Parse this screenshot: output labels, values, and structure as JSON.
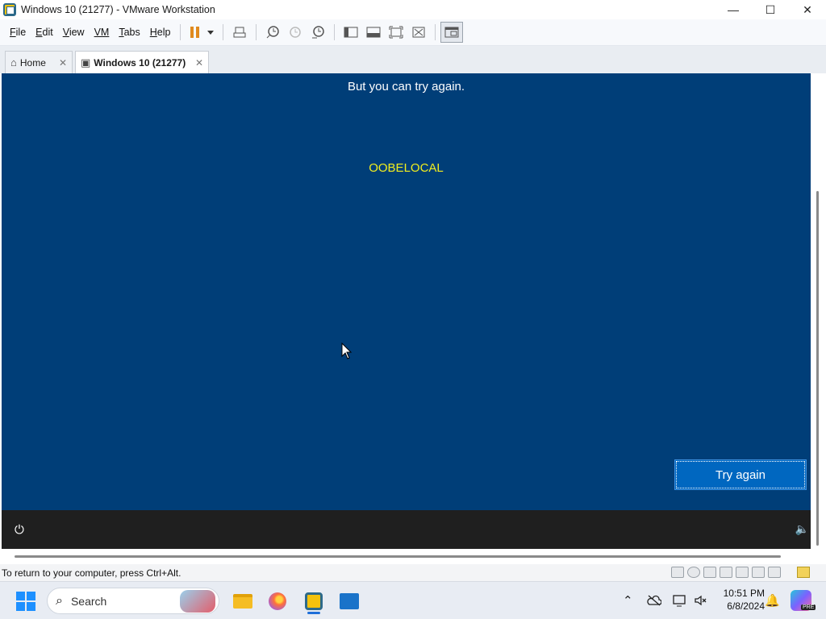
{
  "window": {
    "title": "Windows 10 (21277) - VMware Workstation",
    "controls": {
      "minimize": "—",
      "maximize": "☐",
      "close": "✕"
    }
  },
  "menu": {
    "items": [
      {
        "underline": "F",
        "rest": "ile"
      },
      {
        "underline": "E",
        "rest": "dit"
      },
      {
        "underline": "V",
        "rest": "iew"
      },
      {
        "underline": "VM",
        "rest": ""
      },
      {
        "underline": "T",
        "rest": "abs"
      },
      {
        "underline": "H",
        "rest": "elp"
      }
    ]
  },
  "toolbar": {
    "icons": [
      "pause-icon",
      "send-ctrl-alt-del-icon",
      "snapshot-take-icon",
      "snapshot-revert-icon",
      "snapshot-manager-icon",
      "library-icon",
      "thumbnail-bar-icon",
      "full-screen-icon",
      "unity-icon",
      "console-view-icon"
    ]
  },
  "tabs": [
    {
      "label": "Home",
      "close": "✕"
    },
    {
      "label": "Windows 10 (21277)",
      "close": "✕"
    }
  ],
  "vm": {
    "subtitle": "But you can try again.",
    "code": "OOBELOCAL",
    "try_again": "Try again",
    "ease_icon": "⏻",
    "volume_icon": "🔈"
  },
  "status": {
    "text": "To return to your computer, press Ctrl+Alt."
  },
  "taskbar": {
    "search_placeholder": "Search",
    "search_icon": "⌕",
    "clock_time": "10:51 PM",
    "clock_date": "6/8/2024",
    "copilot_badge": "PRE",
    "tray_icons": [
      "chevron-up-icon",
      "onedrive-icon",
      "display-icon",
      "volume-muted-icon"
    ]
  },
  "colors": {
    "vm_background": "#003e78",
    "accent_button": "#0067c0",
    "code_text": "#f1ee1e"
  }
}
